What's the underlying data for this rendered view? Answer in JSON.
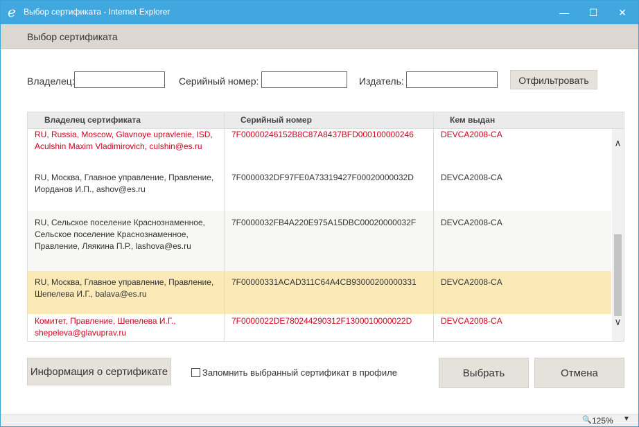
{
  "window": {
    "title": "Выбор сертификата - Internet Explorer",
    "min_glyph": "—",
    "max_glyph": "☐",
    "close_glyph": "✕",
    "accent_color": "#40a8de"
  },
  "dialog": {
    "title": "Выбор сертификата"
  },
  "filters": {
    "owner_label": "Владелец:",
    "owner_value": "",
    "serial_label": "Серийный номер:",
    "serial_value": "",
    "issuer_label": "Издатель:",
    "issuer_value": "",
    "filter_button": "Отфильтровать"
  },
  "table": {
    "columns": [
      "Владелец сертификата",
      "Серийный номер",
      "Кем выдан"
    ],
    "rows": [
      {
        "owner": "RU, Russia, Moscow, Glavnoye upravlenie, ISD, Aculshin Maxim Vladimirovich, culshin@es.ru",
        "serial": "7F00000246152B8C87A8437BFD000100000246",
        "issuer": "DEVCA2008-CA",
        "status": "invalid"
      },
      {
        "owner": "RU, Москва, Главное управление, Правление, Иорданов И.П., ashov@es.ru",
        "serial": "7F0000032DF97FE0A73319427F00020000032D",
        "issuer": "DEVCA2008-CA",
        "status": "normal"
      },
      {
        "owner": "RU, Сельское поселение Краснознаменное, Сельское поселение Краснознаменное, Правление, Ляякина П.Р., lashova@es.ru",
        "serial": "7F0000032FB4A220E975A15DBC00020000032F",
        "issuer": "DEVCA2008-CA",
        "status": "normal"
      },
      {
        "owner": "RU, Москва, Главное управление, Правление, Шепелева И.Г., balava@es.ru",
        "serial": "7F00000331ACAD311C64A4CB93000200000331",
        "issuer": "DEVCA2008-CA",
        "status": "selected"
      },
      {
        "owner": "Комитет, Правление, Шепелева И.Г., shepeleva@glavuprav.ru",
        "serial": "7F0000022DE780244290312F1300010000022D",
        "issuer": "DEVCA2008-CA",
        "status": "invalid"
      }
    ],
    "scroll_up_glyph": "∧",
    "scroll_down_glyph": "∨",
    "invalid_color": "#d0021b",
    "selected_color": "#fbe9b7"
  },
  "actions": {
    "info_button": "Информация о сертификате",
    "remember_label": "Запомнить выбранный сертификат в профиле",
    "remember_checked": false,
    "select_button": "Выбрать",
    "cancel_button": "Отмена"
  },
  "statusbar": {
    "zoom_icon": "zoom-icon",
    "zoom_glyph": "🔍",
    "zoom": "125%",
    "caret": "▼"
  }
}
